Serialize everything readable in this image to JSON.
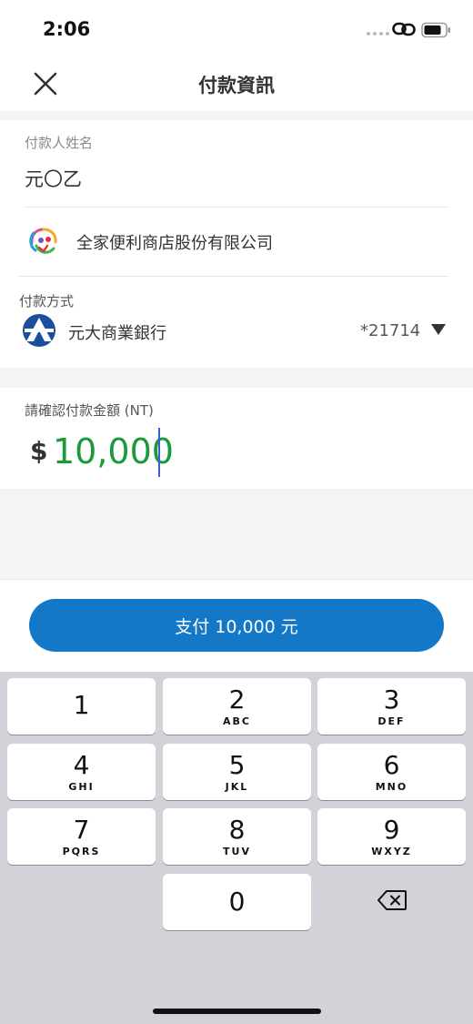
{
  "status_bar": {
    "time": "2:06",
    "link_icon": "link-icon",
    "battery_icon": "battery-icon"
  },
  "nav": {
    "title": "付款資訊",
    "close_icon": "close-icon"
  },
  "payer": {
    "label": "付款人姓名",
    "name": "元〇乙"
  },
  "merchant": {
    "name": "全家便利商店股份有限公司",
    "logo_icon": "familymart-logo"
  },
  "payment_method": {
    "label": "付款方式",
    "bank_name": "元大商業銀行",
    "account_suffix": "*21714",
    "bank_icon": "yuanta-logo"
  },
  "amount": {
    "label": "請確認付款金額 (NT)",
    "currency": "$",
    "value": "10,000",
    "color": "#1a9a3a"
  },
  "pay_button": {
    "label": "支付 10,000 元",
    "color": "#1378c8"
  },
  "keypad": {
    "keys": [
      {
        "num": "1",
        "letters": ""
      },
      {
        "num": "2",
        "letters": "ABC"
      },
      {
        "num": "3",
        "letters": "DEF"
      },
      {
        "num": "4",
        "letters": "GHI"
      },
      {
        "num": "5",
        "letters": "JKL"
      },
      {
        "num": "6",
        "letters": "MNO"
      },
      {
        "num": "7",
        "letters": "PQRS"
      },
      {
        "num": "8",
        "letters": "TUV"
      },
      {
        "num": "9",
        "letters": "WXYZ"
      },
      {
        "num": "0",
        "letters": ""
      }
    ],
    "backspace_icon": "backspace-icon"
  }
}
